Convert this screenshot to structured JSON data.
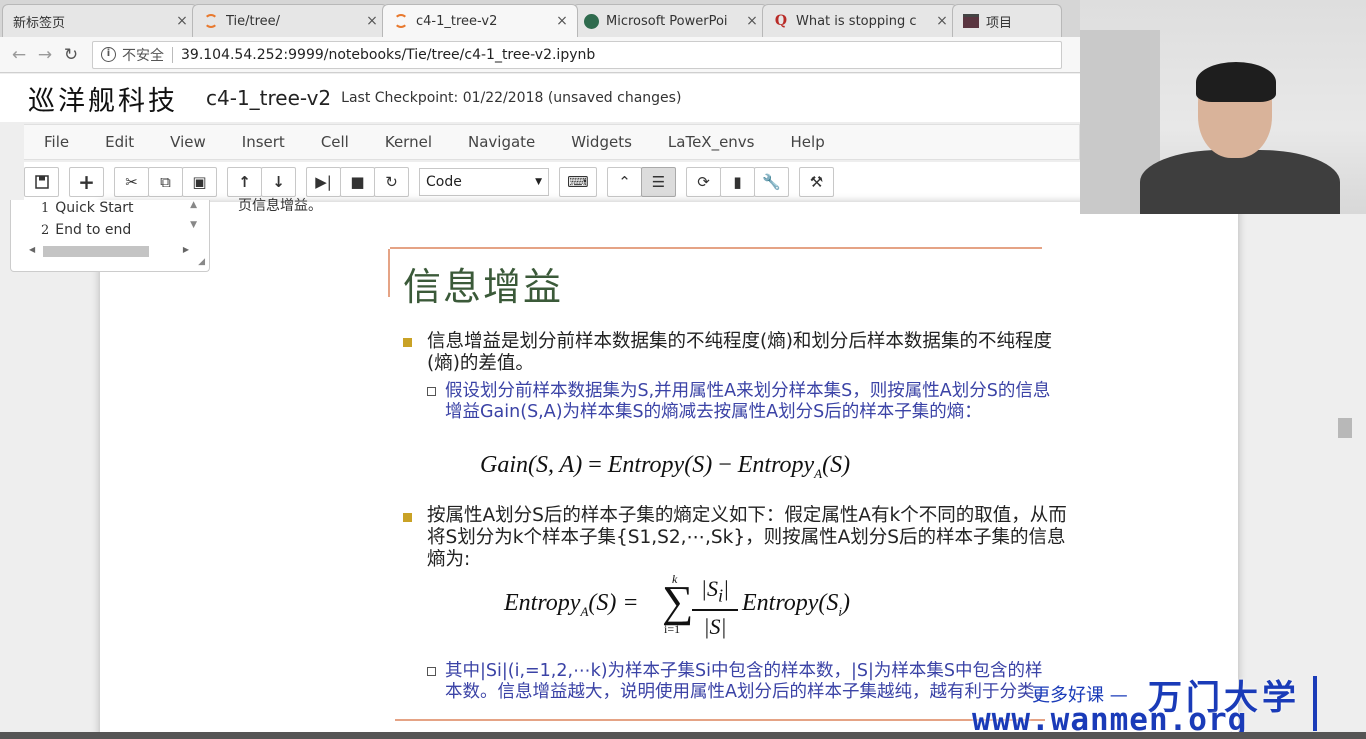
{
  "browser": {
    "tabs": [
      {
        "label": "新标签页",
        "icon": "none",
        "active": false
      },
      {
        "label": "Tie/tree/",
        "icon": "jupyter-icon",
        "active": false
      },
      {
        "label": "c4-1_tree-v2",
        "icon": "jupyter-icon",
        "active": true
      },
      {
        "label": "Microsoft PowerPoi",
        "icon": "powerpoint-icon",
        "active": false
      },
      {
        "label": "What is stopping c",
        "icon": "quora-icon",
        "active": false
      },
      {
        "label": "项目",
        "icon": "project-icon",
        "active": false
      }
    ],
    "close_glyph": "×",
    "insecure_label": "不安全",
    "url": "39.104.54.252:9999/notebooks/Tie/tree/c4-1_tree-v2.ipynb"
  },
  "jupyter": {
    "logo_text": "巡洋舰科技",
    "notebook_name": "c4-1_tree-v2",
    "checkpoint": "Last Checkpoint: 01/22/2018 (unsaved changes)",
    "menu": [
      "File",
      "Edit",
      "View",
      "Insert",
      "Cell",
      "Kernel",
      "Navigate",
      "Widgets",
      "LaTeX_envs",
      "Help"
    ],
    "cell_type": "Code"
  },
  "toc": {
    "items": [
      {
        "num": "1",
        "label": "Quick Start"
      },
      {
        "num": "2",
        "label": "End to end"
      }
    ]
  },
  "cut_text": "页信息增益。",
  "slide": {
    "title": "信息增益",
    "bullet1": "信息增益是划分前样本数据集的不纯程度(熵)和划分后样本数据集的不纯程度(熵)的差值。",
    "sub1": "假设划分前样本数据集为S,并用属性A来划分样本集S，则按属性A划分S的信息增益Gain(S,A)为样本集S的熵减去按属性A划分S后的样本子集的熵：",
    "formula1": {
      "lhs": "Gain(S, A)",
      "eq": " = ",
      "t1": "Entropy(S)",
      "minus": " − ",
      "t2": "Entropy",
      "sub": "A",
      "t3": "(S)"
    },
    "bullet2": "按属性A划分S后的样本子集的熵定义如下：假定属性A有k个不同的取值，从而将S划分为k个样本子集{S1,S2,⋯,Sk}，则按属性A划分S后的样本子集的信息熵为:",
    "formula2": {
      "lhs": "Entropy",
      "lhs_sub": "A",
      "lhs_tail": "(S) =",
      "sigma": "∑",
      "upper": "k",
      "lower": "i=1",
      "num": "|S",
      "num_sub": "i",
      "num_tail": "|",
      "den": "|S|",
      "rhs": "Entropy(S",
      "rhs_sub": "i",
      "rhs_tail": ")"
    },
    "sub2": "其中|Si|(i,=1,2,⋯k)为样本子集Si中包含的样本数，|S|为样本集S中包含的样本数。信息增益越大，说明使用属性A划分后的样本子集越纯，越有利于分类。"
  },
  "watermark": {
    "line1": "更多好课 —",
    "brand": "万门大学",
    "url": "www.wanmen.org"
  },
  "colors": {
    "slide_title": "#3b5a39",
    "sub_text": "#3b43a6",
    "bullet": "#c9a226",
    "slide_rule": "#e5a385",
    "watermark": "#1a3bb8"
  }
}
